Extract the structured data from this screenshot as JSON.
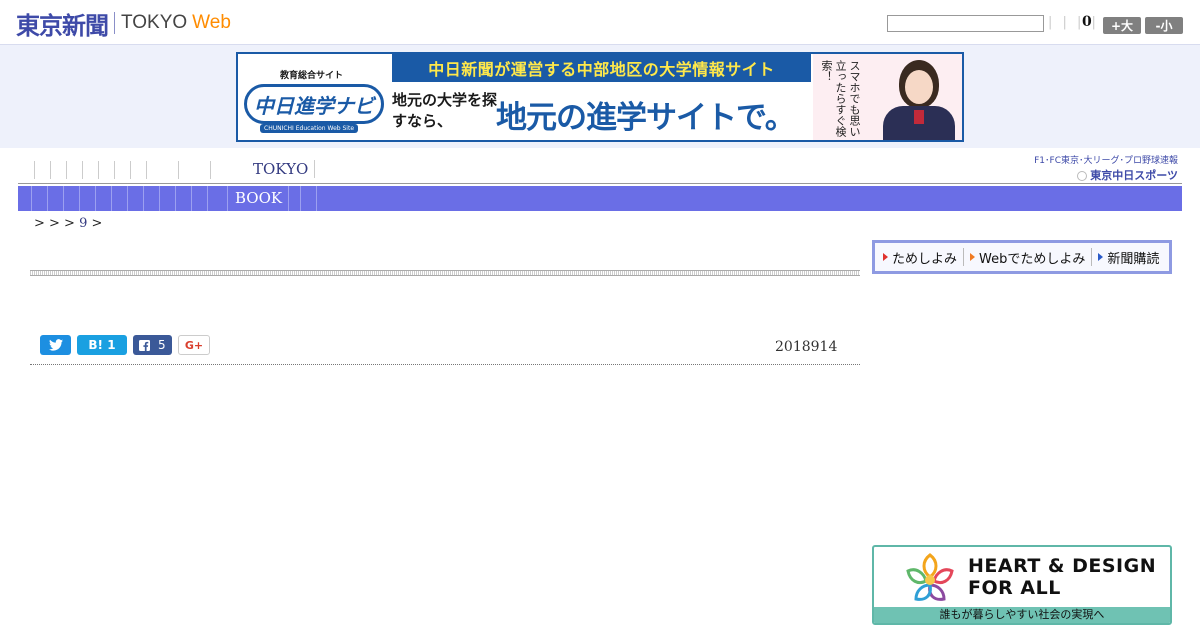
{
  "header": {
    "logo_jp": "東京新聞",
    "logo_tokyo": "TOKYO",
    "logo_web": "Web",
    "search_value": "",
    "pipes": "| | | |",
    "count": "0",
    "size_large": "+大",
    "size_small": "-小"
  },
  "ad_banner": {
    "navi_small": "教育総合サイト",
    "navi_logo": "中日進学ナビ",
    "navi_sub": "CHUNICHI Education Web Site",
    "top_text": "中日新聞が運営する中部地区の大学情報サイト",
    "mid_small": "地元の大学を探すなら、",
    "mid_big": "地元の進学サイトで。",
    "photo_text": "スマホでも思い立ったらすぐ検索！"
  },
  "topnav": {
    "tokyo_label": "TOKYO",
    "sports_small": "F1･FC東京･大リーグ･プロ野球速報",
    "sports_brand": "東京中日スポーツ"
  },
  "navbar": {
    "book_label": "BOOK"
  },
  "breadcrumb": {
    "text1": "> > >",
    "link": "9",
    "text2": ">"
  },
  "article": {
    "date": "2018914",
    "share": {
      "twitter_icon": "twitter-bird",
      "hatena_label": "B!",
      "hatena_count": "1",
      "facebook_count": "5",
      "gplus_label": "G+"
    }
  },
  "subscribe": {
    "item1": "ためしよみ",
    "item2": "Webでためしよみ",
    "item3": "新聞購読",
    "arrow_colors": [
      "#e0322e",
      "#f07a22",
      "#2a5ac8"
    ]
  },
  "bottom_ad": {
    "title_line1": "HEART & DESIGN",
    "title_line2": "FOR ALL",
    "caption": "誰もが暮らしやすい社会の実現へ"
  },
  "colors": {
    "brand_blue": "#3e4aa8",
    "nav_bar": "#6a6ee6",
    "web_orange": "#ff8c00"
  }
}
